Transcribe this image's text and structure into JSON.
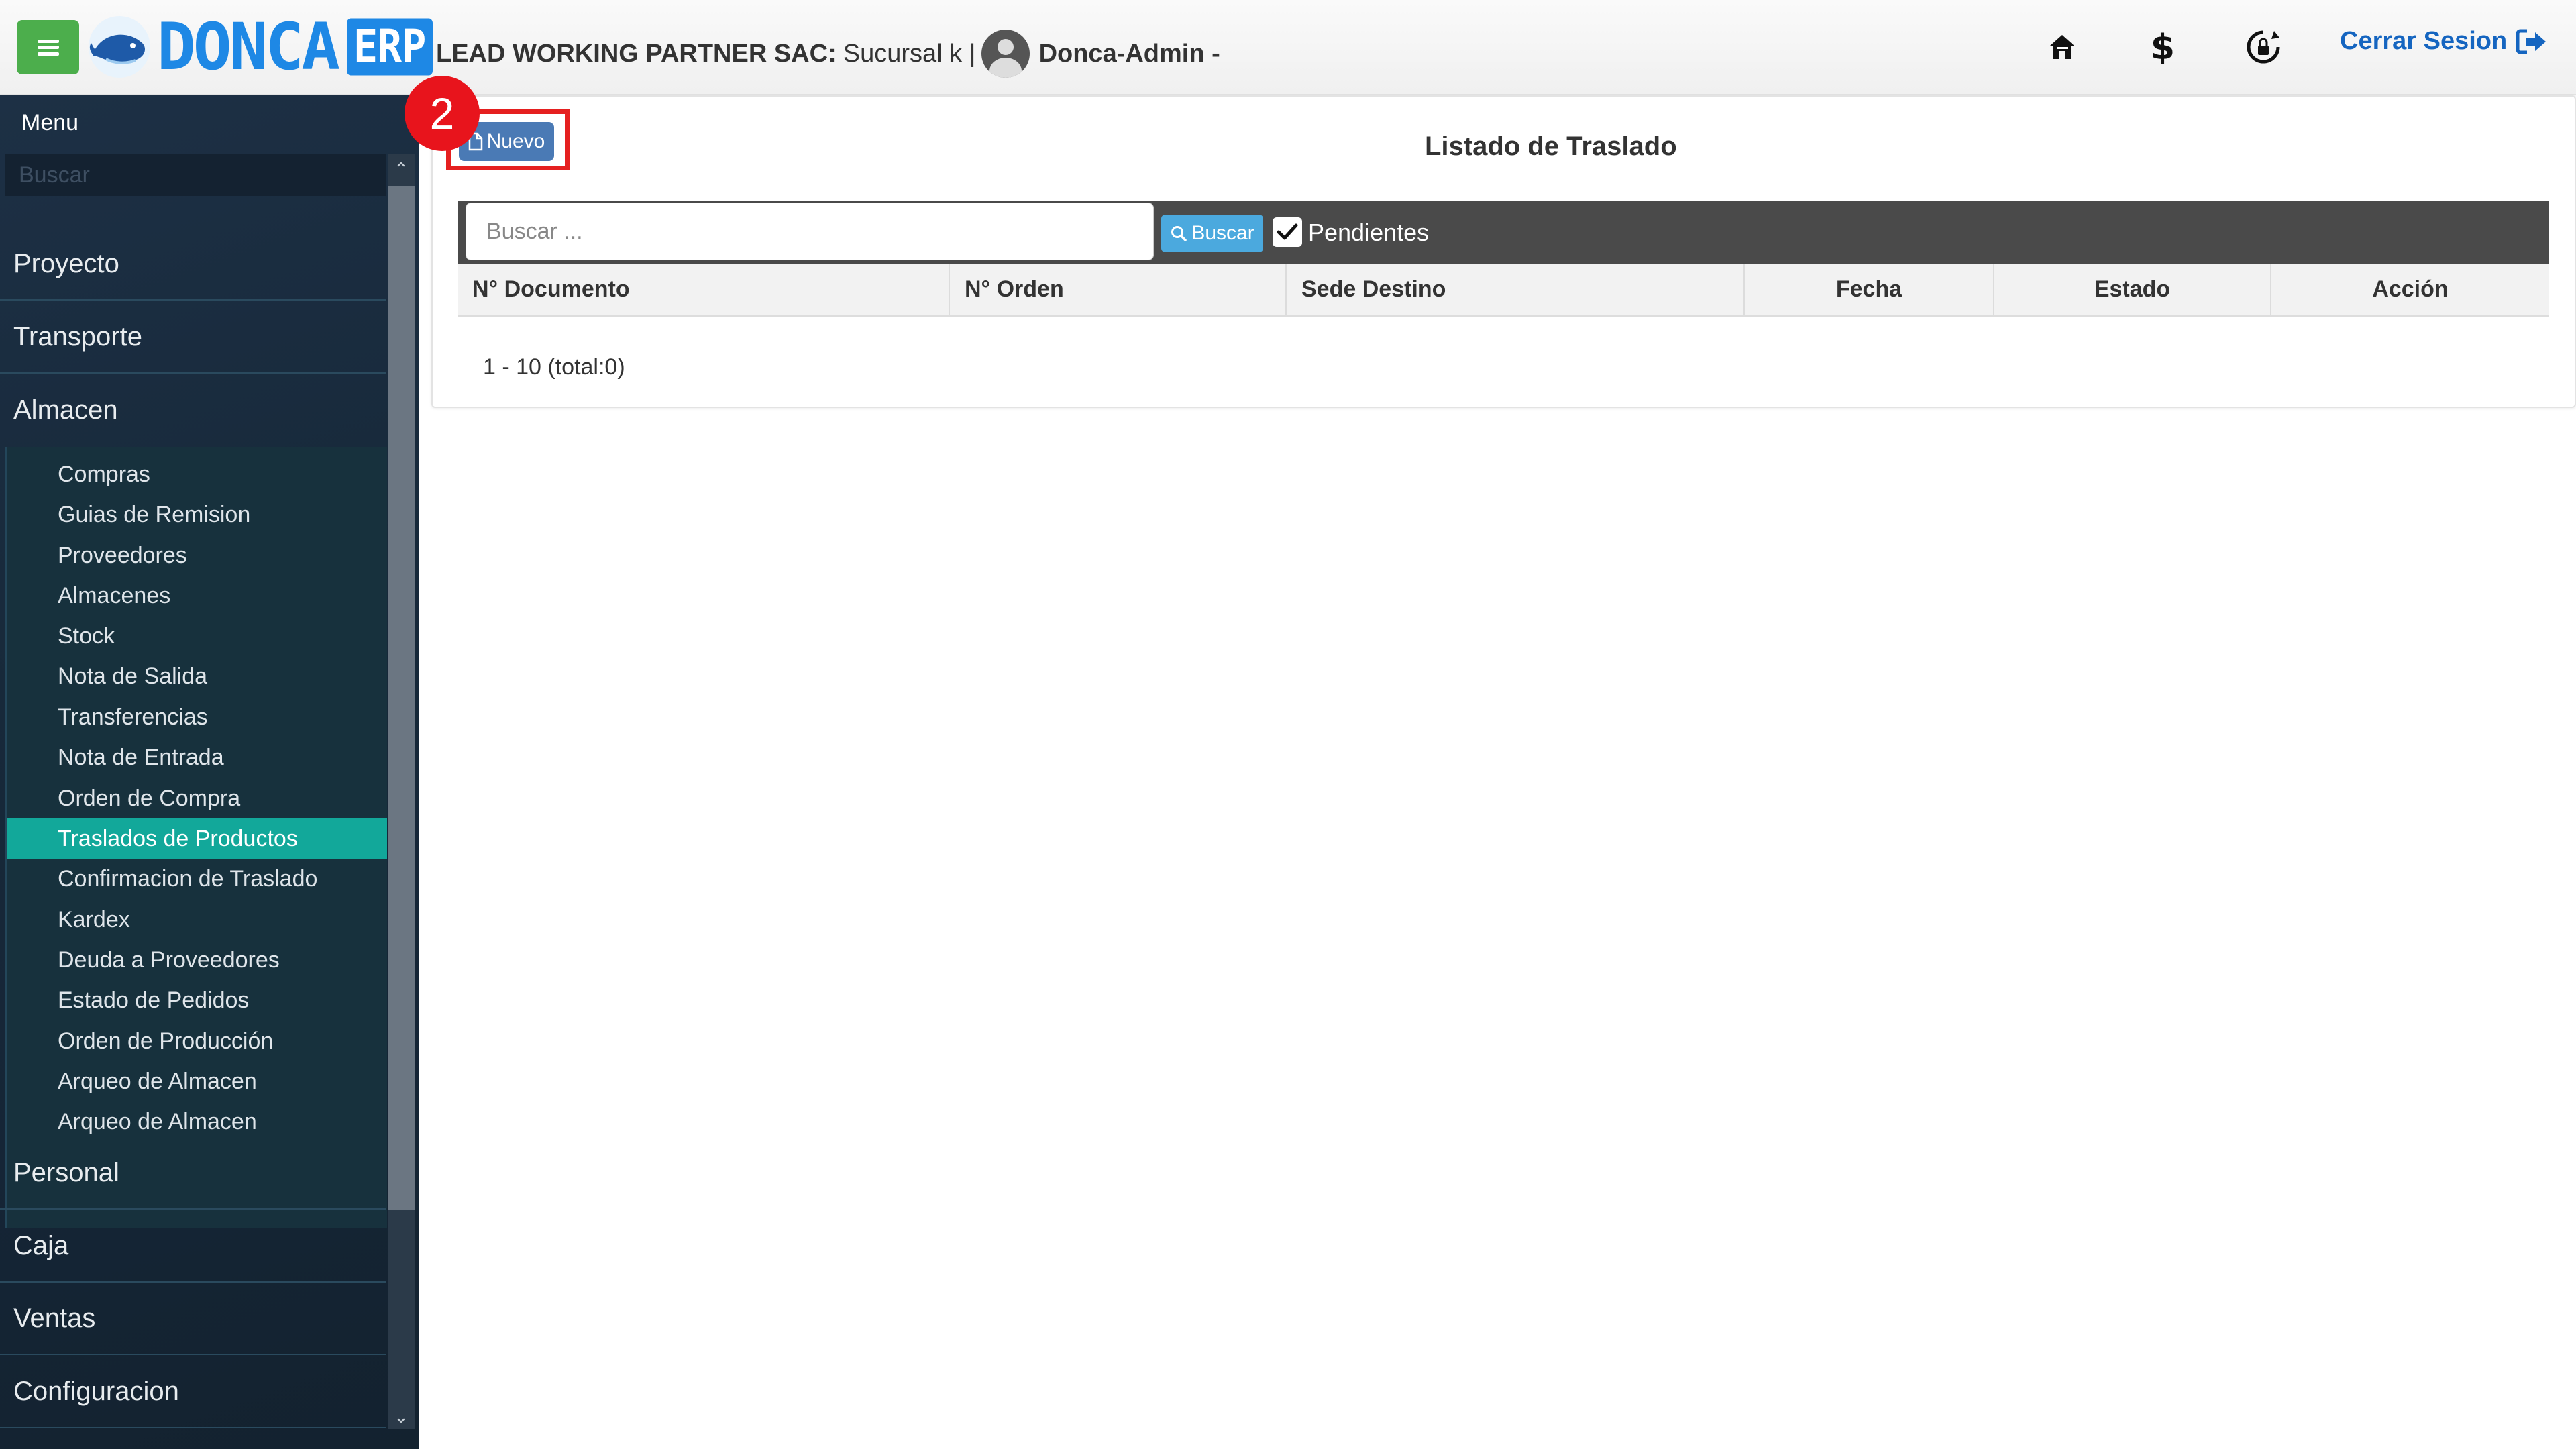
{
  "header": {
    "logo_text": "DONCA",
    "logo_badge": "ERP",
    "company_label": "LEAD WORKING PARTNER SAC:",
    "branch_label": "Sucursal k |",
    "user_label": "Donca-Admin -",
    "logout_label": "Cerrar Sesion",
    "icons": [
      "home-icon",
      "dollar-icon",
      "lock-refresh-icon",
      "logout-icon"
    ]
  },
  "sidebar": {
    "title": "Menu",
    "search_placeholder": "Buscar",
    "items_top": [
      "Proyecto",
      "Transporte",
      "Almacen"
    ],
    "submenu": [
      "Compras",
      "Guias de Remision",
      "Proveedores",
      "Almacenes",
      "Stock",
      "Nota de Salida",
      "Transferencias",
      "Nota de Entrada",
      "Orden de Compra",
      "Traslados de Productos",
      "Confirmacion de Traslado",
      "Kardex",
      "Deuda a Proveedores",
      "Estado de Pedidos",
      "Orden de Producción",
      "Arqueo de Almacen",
      "Arqueo de Almacen"
    ],
    "active_submenu": "Traslados de Productos",
    "items_bottom": [
      "Personal",
      "Caja",
      "Ventas",
      "Configuracion"
    ]
  },
  "main": {
    "new_button_label": "Nuevo",
    "annotation_step": "2",
    "title": "Listado de Traslado",
    "search_placeholder": "Buscar ...",
    "search_button_label": "Buscar",
    "pending_label": "Pendientes",
    "pending_checked": true,
    "table_headers": [
      "N° Documento",
      "N° Orden",
      "Sede Destino",
      "Fecha",
      "Estado",
      "Acción"
    ],
    "pagination": "1 - 10 (total:0)"
  },
  "colors": {
    "menu_button": "#4cae4c",
    "brand_blue": "#1e88e5",
    "sidebar_bg": "#17293a",
    "active_item": "#12a89a",
    "annotation_red": "#e52020",
    "search_bar_bg": "#4a4a4a"
  }
}
